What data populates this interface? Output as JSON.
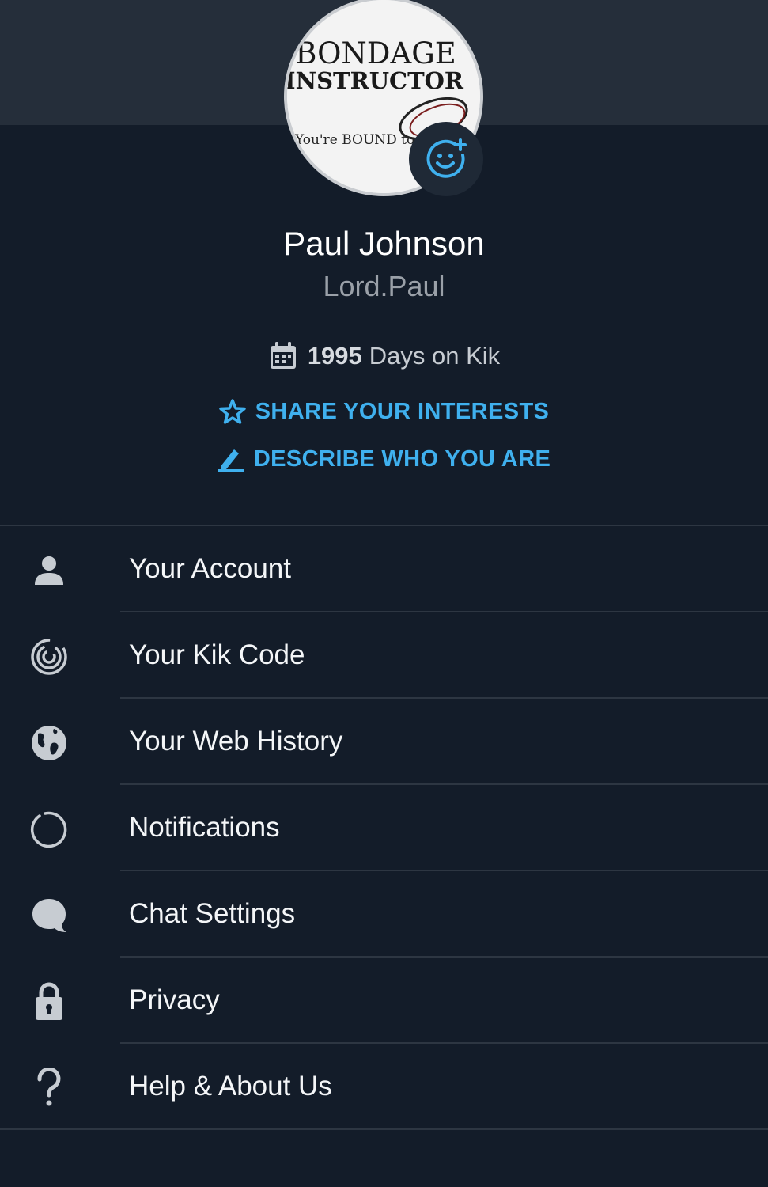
{
  "profile": {
    "avatar_text": {
      "line1": "BONDAGE",
      "line2": "INSTRUCTOR",
      "tagline": "You're BOUND to ha"
    },
    "name": "Paul Johnson",
    "username": "Lord.Paul",
    "days_count": "1995",
    "days_suffix": "Days on Kik"
  },
  "actions": {
    "share_interests": "SHARE YOUR INTERESTS",
    "describe": "DESCRIBE WHO YOU ARE"
  },
  "menu": {
    "items": [
      {
        "label": "Your Account",
        "icon": "person-icon"
      },
      {
        "label": "Your Kik Code",
        "icon": "kik-code-icon"
      },
      {
        "label": "Your Web History",
        "icon": "globe-icon"
      },
      {
        "label": "Notifications",
        "icon": "notification-ring-icon"
      },
      {
        "label": "Chat Settings",
        "icon": "chat-bubble-icon"
      },
      {
        "label": "Privacy",
        "icon": "lock-icon"
      },
      {
        "label": "Help & About Us",
        "icon": "help-icon"
      }
    ]
  },
  "colors": {
    "background": "#131c29",
    "header_band": "#252e3a",
    "accent": "#3fb0ee",
    "divider": "#2d3642"
  }
}
